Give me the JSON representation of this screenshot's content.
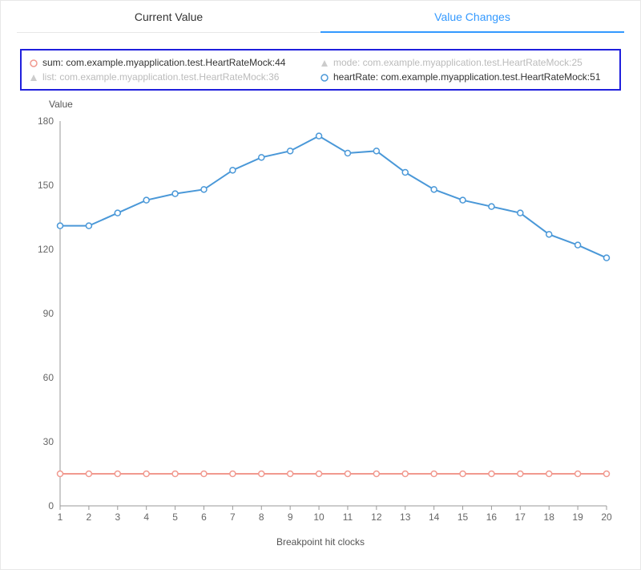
{
  "tabs": {
    "current_value": "Current Value",
    "value_changes": "Value Changes"
  },
  "legend": {
    "sum": "sum: com.example.myapplication.test.HeartRateMock:44",
    "mode": "mode: com.example.myapplication.test.HeartRateMock:25",
    "list": "list: com.example.myapplication.test.HeartRateMock:36",
    "heartRate": "heartRate: com.example.myapplication.test.HeartRateMock:51"
  },
  "chart_data": {
    "type": "line",
    "title": "",
    "xlabel": "Breakpoint hit clocks",
    "ylabel": "Value",
    "ylim": [
      0,
      180
    ],
    "yticks": [
      0,
      30,
      60,
      90,
      120,
      150,
      180
    ],
    "x": [
      1,
      2,
      3,
      4,
      5,
      6,
      7,
      8,
      9,
      10,
      11,
      12,
      13,
      14,
      15,
      16,
      17,
      18,
      19,
      20
    ],
    "series": [
      {
        "name": "heartRate",
        "color": "#4a98d8",
        "marker": "circle-open",
        "values": [
          131,
          131,
          137,
          143,
          146,
          148,
          157,
          163,
          166,
          173,
          165,
          166,
          156,
          148,
          143,
          140,
          137,
          127,
          122,
          116
        ]
      },
      {
        "name": "sum",
        "color": "#f1998f",
        "marker": "circle-open",
        "values": [
          15,
          15,
          15,
          15,
          15,
          15,
          15,
          15,
          15,
          15,
          15,
          15,
          15,
          15,
          15,
          15,
          15,
          15,
          15,
          15
        ]
      }
    ]
  }
}
